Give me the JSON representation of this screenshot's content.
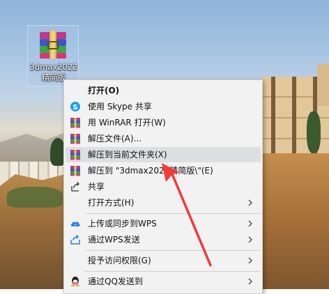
{
  "desktop": {
    "icon": {
      "line1": "3dmax2022",
      "line2": "精简版"
    }
  },
  "menu": {
    "items": [
      {
        "label": "打开(O)",
        "icon": "none"
      },
      {
        "label": "使用 Skype 共享",
        "icon": "skype-icon"
      },
      {
        "label": "用 WinRAR 打开(W)",
        "icon": "winrar-icon"
      },
      {
        "label": "解压文件(A)...",
        "icon": "winrar-icon"
      },
      {
        "label": "解压到当前文件夹(X)",
        "icon": "winrar-icon"
      },
      {
        "label": "解压到 \"3dmax2022精简版\\\"(E)",
        "icon": "winrar-icon"
      },
      {
        "label": "共享",
        "icon": "share-icon"
      },
      {
        "label": "打开方式(H)",
        "icon": "none"
      },
      {
        "label": "上传或同步到WPS",
        "icon": "wps-cloud-icon"
      },
      {
        "label": "通过WPS发送",
        "icon": "wps-send-icon"
      },
      {
        "label": "授予访问权限(G)",
        "icon": "none"
      },
      {
        "label": "通过QQ发送到",
        "icon": "qq-icon"
      }
    ]
  },
  "colors": {
    "annotation_arrow": "#f03c3c",
    "menu_background": "#f2f2f2",
    "hover_highlight": "#dddfe2"
  }
}
